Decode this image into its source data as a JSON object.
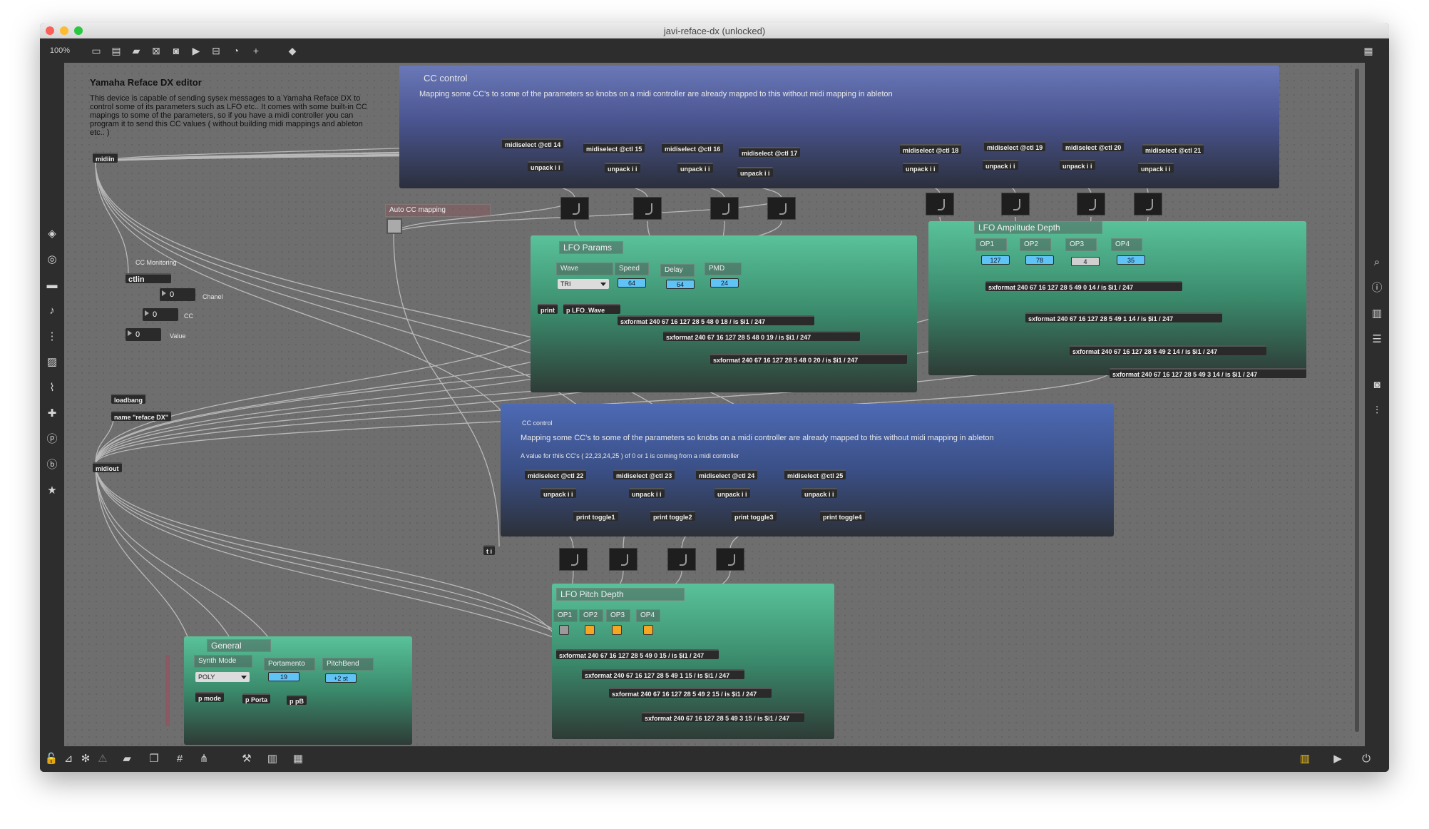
{
  "window": {
    "title": "javi-reface-dx (unlocked)"
  },
  "toolbar": {
    "zoom": "100%"
  },
  "intro": {
    "title": "Yamaha Reface DX editor",
    "text": "This device is capable of sending sysex messages to  a Yamaha Reface DX to control some of its parameters such as LFO etc.. It comes with some built-in CC mapings to some of the parameters, so if you have a midi controller you can program it to send this CC values ( without building midi mappings and ableton etc.. )"
  },
  "objects": {
    "midiin": "midiin",
    "midiout": "midiout",
    "loadbang": "loadbang",
    "name_reface": "name \"reface DX\"",
    "ctlin": "ctlin",
    "ti": "t i"
  },
  "cc_monitor": {
    "title": "CC Monitoring",
    "chanel_label": "Chanel",
    "cc_label": "CC",
    "value_label": "Value",
    "chanel": "0",
    "cc": "0",
    "value": "0"
  },
  "auto_cc": {
    "label": "Auto CC mapping"
  },
  "cc_top": {
    "title": "CC control",
    "desc": "Mapping some CC's to some of the parameters so knobs on a midi controller are already mapped to this without midi mapping in ableton",
    "selects": [
      "midiselect @ctl 14",
      "midiselect @ctl 15",
      "midiselect @ctl 16",
      "midiselect @ctl 17",
      "midiselect @ctl 18",
      "midiselect @ctl 19",
      "midiselect @ctl 20",
      "midiselect @ctl 21"
    ],
    "unpack": "unpack i i"
  },
  "lfo_params": {
    "title": "LFO Params",
    "wave_label": "Wave",
    "wave_value": "TRI",
    "speed_label": "Speed",
    "speed_value": "64",
    "delay_label": "Delay",
    "delay_value": "64",
    "pmd_label": "PMD",
    "pmd_value": "24",
    "print": "print",
    "p_lfo_wave": "p LFO_Wave",
    "sx": [
      "sxformat 240 67 16 127 28 5 48 0 18 / is $i1 / 247",
      "sxformat 240 67 16 127 28 5 48 0 19 / is $i1 / 247",
      "sxformat 240 67 16 127 28 5 48 0 20 / is $i1 / 247"
    ]
  },
  "lfo_amp": {
    "title": "LFO Amplitude Depth",
    "ops": [
      "OP1",
      "OP2",
      "OP3",
      "OP4"
    ],
    "values": [
      "127",
      "78",
      "4",
      "35"
    ],
    "sx": [
      "sxformat 240 67 16 127 28 5 49 0 14 / is $i1 / 247",
      "sxformat 240 67 16 127 28 5 49 1 14 / is $i1 / 247",
      "sxformat 240 67 16 127 28 5 49 2 14 / is $i1 / 247",
      "sxformat 240 67 16 127 28 5 49 3 14 / is $i1 / 247"
    ]
  },
  "cc_bottom": {
    "small_title": "CC control",
    "desc": "Mapping some CC's to some of the parameters so knobs on a midi controller are already mapped to this without midi mapping in ableton",
    "note": "A value for thiis CC's ( 22,23,24,25 ) of 0 or 1 is coming from a midi controller",
    "selects": [
      "midiselect @ctl 22",
      "midiselect @ctl 23",
      "midiselect @ctl 24",
      "midiselect @ctl 25"
    ],
    "prints": [
      "print toggle1",
      "print toggle2",
      "print toggle3",
      "print toggle4"
    ],
    "unpack": "unpack i i"
  },
  "lfo_pitch": {
    "title": "LFO Pitch Depth",
    "ops": [
      "OP1",
      "OP2",
      "OP3",
      "OP4"
    ],
    "sx": [
      "sxformat 240 67 16 127 28 5 49 0 15 / is $i1 / 247",
      "sxformat 240 67 16 127 28 5 49 1 15 / is $i1 / 247",
      "sxformat 240 67 16 127 28 5 49 2 15 / is $i1 / 247",
      "sxformat 240 67 16 127 28 5 49 3 15 / is $i1 / 247"
    ],
    "toggle_colors": [
      "#9a9a9a",
      "#f5a623",
      "#f5a623",
      "#f5a623"
    ]
  },
  "general": {
    "title": "General",
    "synth_label": "Synth Mode",
    "synth_value": "POLY",
    "porta_label": "Portamento",
    "porta_value": "19",
    "pb_label": "PitchBend",
    "pb_value": "+2 st",
    "p_mode": "p mode",
    "p_porta": "p Porta",
    "p_pb": "p pB"
  },
  "colors": {
    "canvas": "#6e6e6e",
    "blue_panel": "#4a5590",
    "green_panel": "#3a8a6c",
    "number_box": "#5fc4f5"
  }
}
